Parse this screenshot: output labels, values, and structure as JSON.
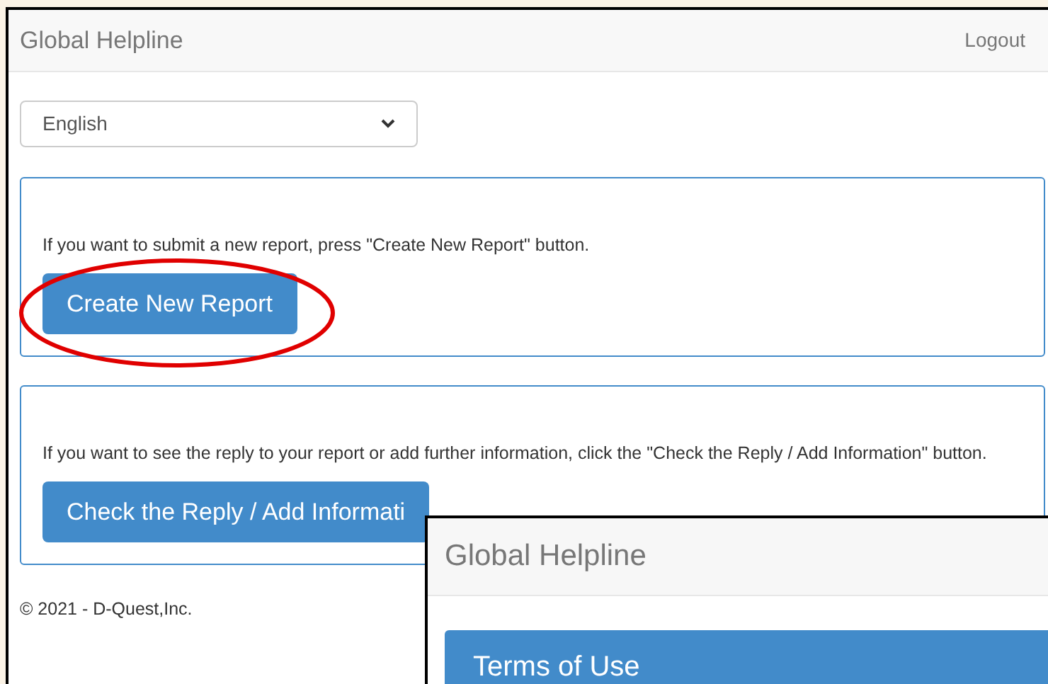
{
  "navbar": {
    "brand": "Global Helpline",
    "logout": "Logout"
  },
  "language_select": {
    "value": "English"
  },
  "panels": [
    {
      "text": "If you want to submit a new report, press \"Create New Report\" button.",
      "button": "Create New Report",
      "highlighted": true
    },
    {
      "text": "If you want to see the reply to your report or add further information, click the \"Check the Reply / Add Information\" button.",
      "button": "Check the Reply / Add Informati",
      "highlighted": false
    }
  ],
  "footer": "© 2021 - D-Quest,Inc.",
  "overlay_window": {
    "brand": "Global Helpline",
    "panel_title": "Terms of Use"
  }
}
